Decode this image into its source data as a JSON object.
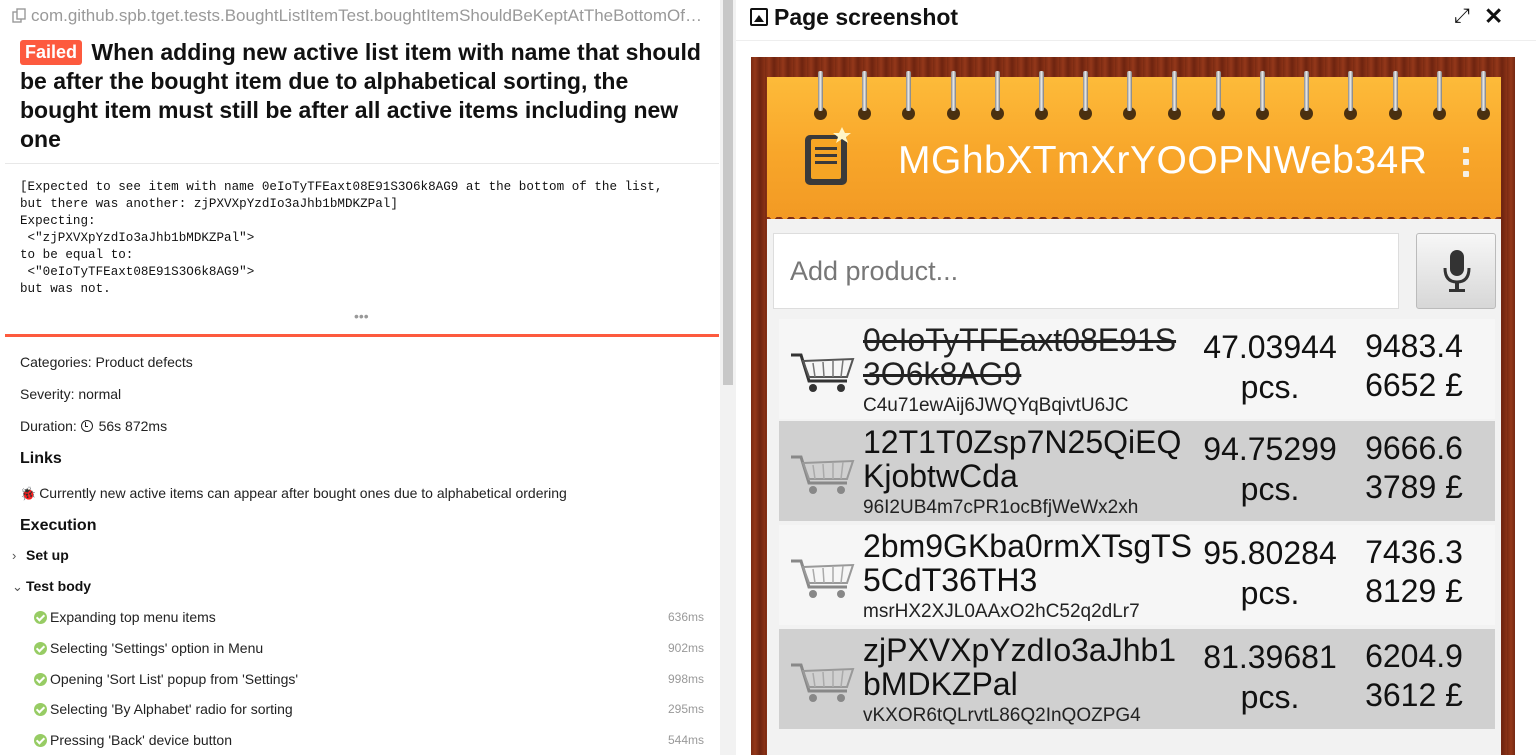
{
  "test": {
    "full_name": "com.github.spb.tget.tests.BoughtListItemTest.boughtItemShouldBeKeptAtTheBottomOfTheList",
    "status": "Failed",
    "title": "When adding new active list item with name that should be after the bought item due to alphabetical sorting, the bought item must still be after all active items including new one",
    "message": "[Expected to see item with name 0eIoTyTFEaxt08E91S3O6k8AG9 at the bottom of the list,\nbut there was another: zjPXVXpYzdIo3aJhb1bMDKZPal]\nExpecting:\n <\"zjPXVXpYzdIo3aJhb1bMDKZPal\">\nto be equal to:\n <\"0eIoTyTFEaxt08E91S3O6k8AG9\">\nbut was not.",
    "more": "•••"
  },
  "info": {
    "categories": "Categories: Product defects",
    "severity": "Severity: normal",
    "duration_label": "Duration:",
    "duration_value": "56s 872ms"
  },
  "links": {
    "heading": "Links",
    "items": [
      "Currently new active items can appear after bought ones due to alphabetical ordering"
    ]
  },
  "execution": {
    "heading": "Execution",
    "setup_label": "Set up",
    "body_label": "Test body",
    "steps": [
      {
        "name": "Expanding top menu items",
        "duration": "636ms"
      },
      {
        "name": "Selecting 'Settings' option in Menu",
        "duration": "902ms"
      },
      {
        "name": "Opening 'Sort List' popup from 'Settings'",
        "duration": "998ms"
      },
      {
        "name": "Selecting 'By Alphabet' radio for sorting",
        "duration": "295ms"
      },
      {
        "name": "Pressing 'Back' device button",
        "duration": "544ms"
      }
    ]
  },
  "screenshot_panel": {
    "title": "Page screenshot",
    "icons": [
      "image-icon",
      "expand-icon",
      "close-icon"
    ]
  },
  "phone": {
    "app_title": "MGhbXTmXrYOOPNWeb34R",
    "add_placeholder": "Add product...",
    "products": [
      {
        "name": "0eIoTyTFEaxt08E91S3O6k8AG9",
        "desc": "C4u71ewAij6JWQYqBqivtU6JC",
        "qty": "47.03944 pcs.",
        "price": "9483.46652 £",
        "bought": true
      },
      {
        "name": "12T1T0Zsp7N25QiEQKjobtwCda",
        "desc": "96I2UB4m7cPR1ocBfjWeWx2xh",
        "qty": "94.75299 pcs.",
        "price": "9666.63789 £",
        "bought": false
      },
      {
        "name": "2bm9GKba0rmXTsgTS5CdT36TH3",
        "desc": "msrHX2XJL0AAxO2hC52q2dLr7",
        "qty": "95.80284 pcs.",
        "price": "7436.38129 £",
        "bought": false
      },
      {
        "name": "zjPXVXpYzdIo3aJhb1bMDKZPal",
        "desc": "vKXOR6tQLrvtL86Q2InQOZPG4",
        "qty": "81.39681 pcs.",
        "price": "6204.93612 £",
        "bought": false
      }
    ]
  },
  "colors": {
    "failed": "#fd5a3e",
    "passed": "#97cc64",
    "app_header": "#f8a62a"
  }
}
